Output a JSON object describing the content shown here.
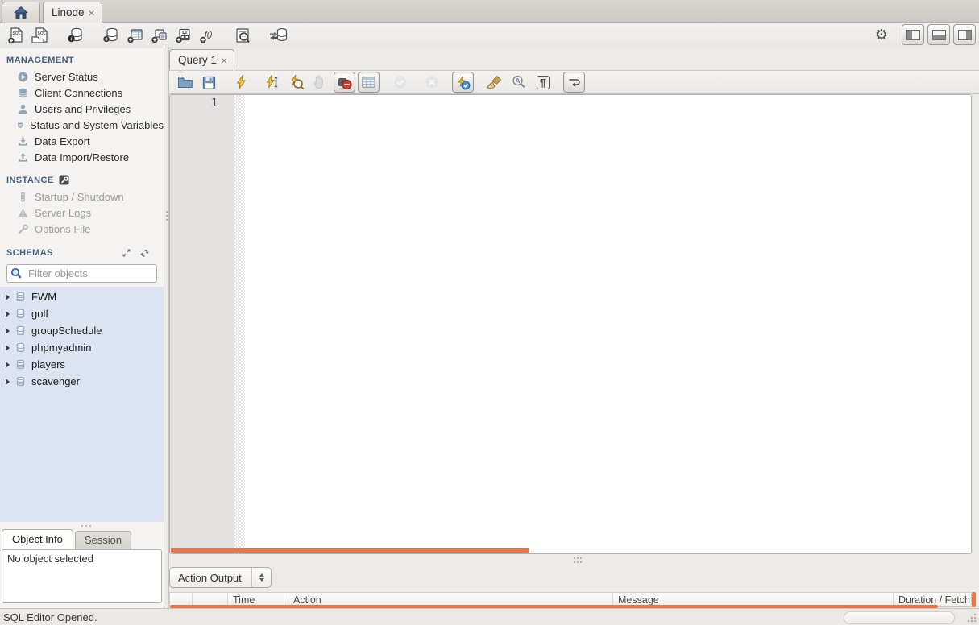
{
  "app": {
    "connection_tab": "Linode",
    "status_message": "SQL Editor Opened."
  },
  "icons": {
    "close": "×",
    "pilcrow": "¶",
    "preferences_glyph": "⚙"
  },
  "main_toolbar": {
    "buttons": [
      "new-query-tab",
      "open-sql-script",
      "schema-inspector",
      "create-schema",
      "create-table",
      "create-view",
      "create-procedure",
      "create-function",
      "search-table-data",
      "reconnect-dbms"
    ]
  },
  "sidebar": {
    "management": {
      "title": "MANAGEMENT",
      "items": [
        {
          "label": "Server Status",
          "icon": "server-status-icon"
        },
        {
          "label": "Client Connections",
          "icon": "client-connections-icon"
        },
        {
          "label": "Users and Privileges",
          "icon": "users-icon"
        },
        {
          "label": "Status and System Variables",
          "icon": "status-variables-icon"
        },
        {
          "label": "Data Export",
          "icon": "data-export-icon"
        },
        {
          "label": "Data Import/Restore",
          "icon": "data-import-icon"
        }
      ]
    },
    "instance": {
      "title": "INSTANCE",
      "items": [
        {
          "label": "Startup / Shutdown",
          "icon": "startup-shutdown-icon",
          "disabled": true
        },
        {
          "label": "Server Logs",
          "icon": "server-logs-icon",
          "disabled": true
        },
        {
          "label": "Options File",
          "icon": "options-file-icon",
          "disabled": true
        }
      ]
    },
    "schemas": {
      "title": "SCHEMAS",
      "filter_placeholder": "Filter objects",
      "items": [
        "FWM",
        "golf",
        "groupSchedule",
        "phpmyadmin",
        "players",
        "scavenger"
      ]
    },
    "bottom_panel": {
      "tabs": [
        "Object Info",
        "Session"
      ],
      "active_tab": "Object Info",
      "content": "No object selected"
    }
  },
  "editor": {
    "tab_label": "Query 1",
    "line_numbers": [
      "1"
    ],
    "content": ""
  },
  "sql_toolbar": {
    "buttons": [
      "open-script",
      "save-script",
      "execute",
      "execute-current-statement",
      "explain",
      "stop",
      "toggle-stop-on-error",
      "limit-rows",
      "commit",
      "rollback",
      "toggle-autocommit",
      "beautify",
      "find",
      "show-invisibles",
      "toggle-word-wrap"
    ]
  },
  "output": {
    "view_selector": "Action Output",
    "columns": [
      "",
      "",
      "Time",
      "Action",
      "Message",
      "Duration / Fetch"
    ]
  },
  "colors": {
    "accent_orange": "#e8764a",
    "schema_list_bg": "#dbe4f0",
    "sidebar_header": "#44607c",
    "toolbar_icon_blue": "#6d93bd",
    "execute_yellow": "#f3ca3e"
  }
}
